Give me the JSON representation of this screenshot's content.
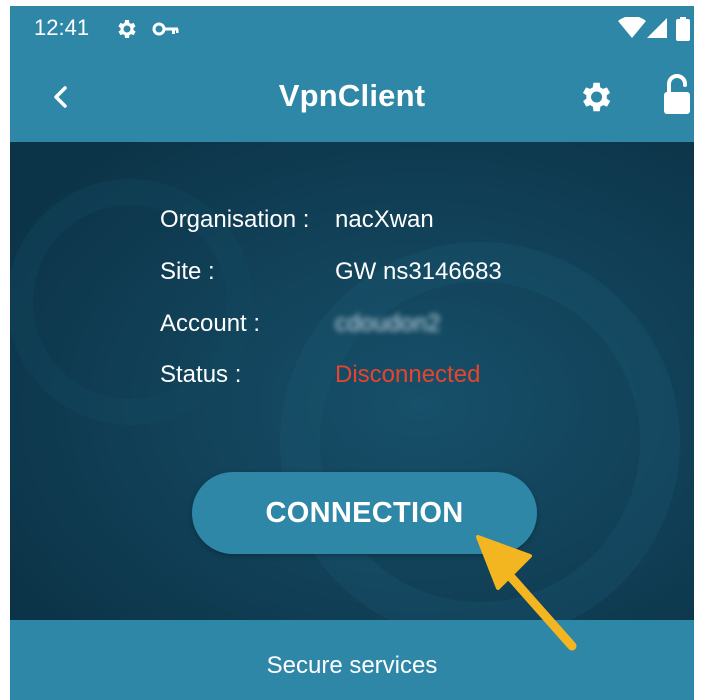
{
  "status_bar": {
    "time": "12:41",
    "left_icons": [
      "gear-icon",
      "key-icon"
    ],
    "right_icons": [
      "wifi-icon",
      "signal-icon",
      "battery-icon"
    ]
  },
  "app_bar": {
    "title": "VpnClient",
    "left_icon": "back-chevron-icon",
    "right_icons": [
      "gear-icon",
      "unlock-icon"
    ]
  },
  "info": {
    "rows": [
      {
        "label": "Organisation :",
        "value": "nacXwan"
      },
      {
        "label": "Site :",
        "value": "GW ns3146683"
      },
      {
        "label": "Account :",
        "value": "cdoudon2"
      },
      {
        "label": "Status :",
        "value": "Disconnected"
      }
    ]
  },
  "connect_button": {
    "label": "CONNECTION"
  },
  "bottom_bar": {
    "label": "Secure services"
  },
  "annotation": {
    "type": "arrow",
    "icon": "pointer-arrow-icon"
  },
  "colors": {
    "primary": "#2f87a7",
    "content_bg": "#0e3b52",
    "status_disconnected": "#e8442d",
    "annotation": "#f3b620"
  }
}
